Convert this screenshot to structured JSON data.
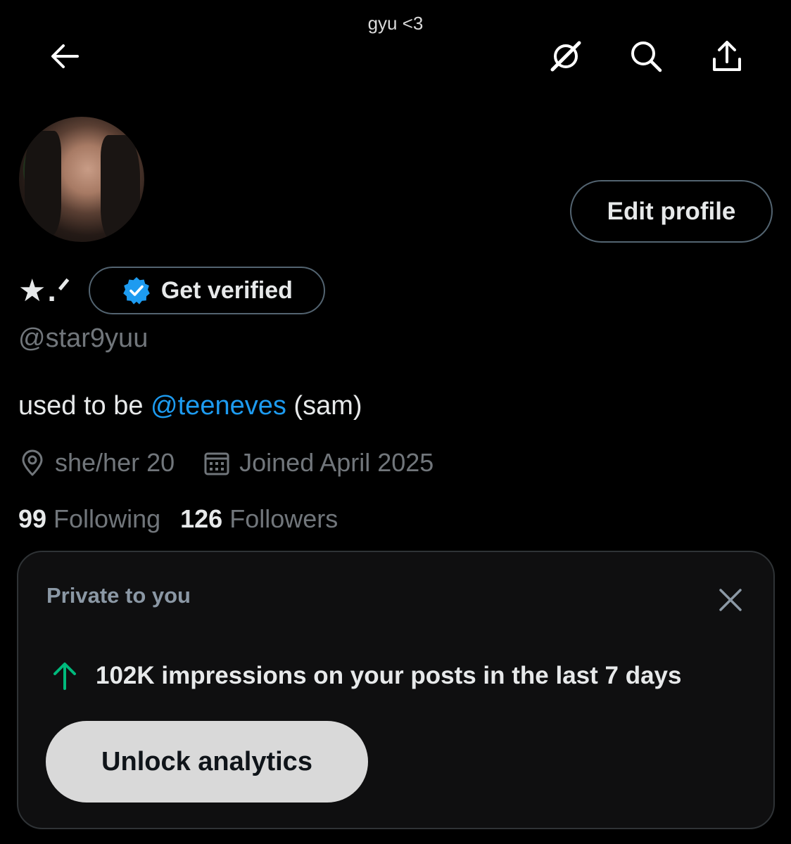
{
  "header": {
    "caption": "gyu <3",
    "icons": [
      "back-arrow-icon",
      "grok-icon",
      "search-icon",
      "share-icon"
    ]
  },
  "profile": {
    "display_name": "★.ᐟ",
    "verify_label": "Get verified",
    "handle": "@star9yuu",
    "edit_label": "Edit profile",
    "bio": {
      "prefix": "used to be ",
      "mention": "@teeneves",
      "suffix": " (sam)"
    },
    "location": "she/her 20",
    "joined": "Joined April 2025",
    "following_count": "99",
    "following_label": "Following",
    "followers_count": "126",
    "followers_label": "Followers"
  },
  "analytics_card": {
    "label": "Private to you",
    "insight": "102K impressions on your posts in the last 7 days",
    "button_label": "Unlock analytics"
  },
  "colors": {
    "background": "#000000",
    "text_primary": "#e7e9ea",
    "text_secondary": "#71767b",
    "accent_blue": "#1d9bf0",
    "trend_green": "#00ba7c",
    "border": "#536471"
  }
}
